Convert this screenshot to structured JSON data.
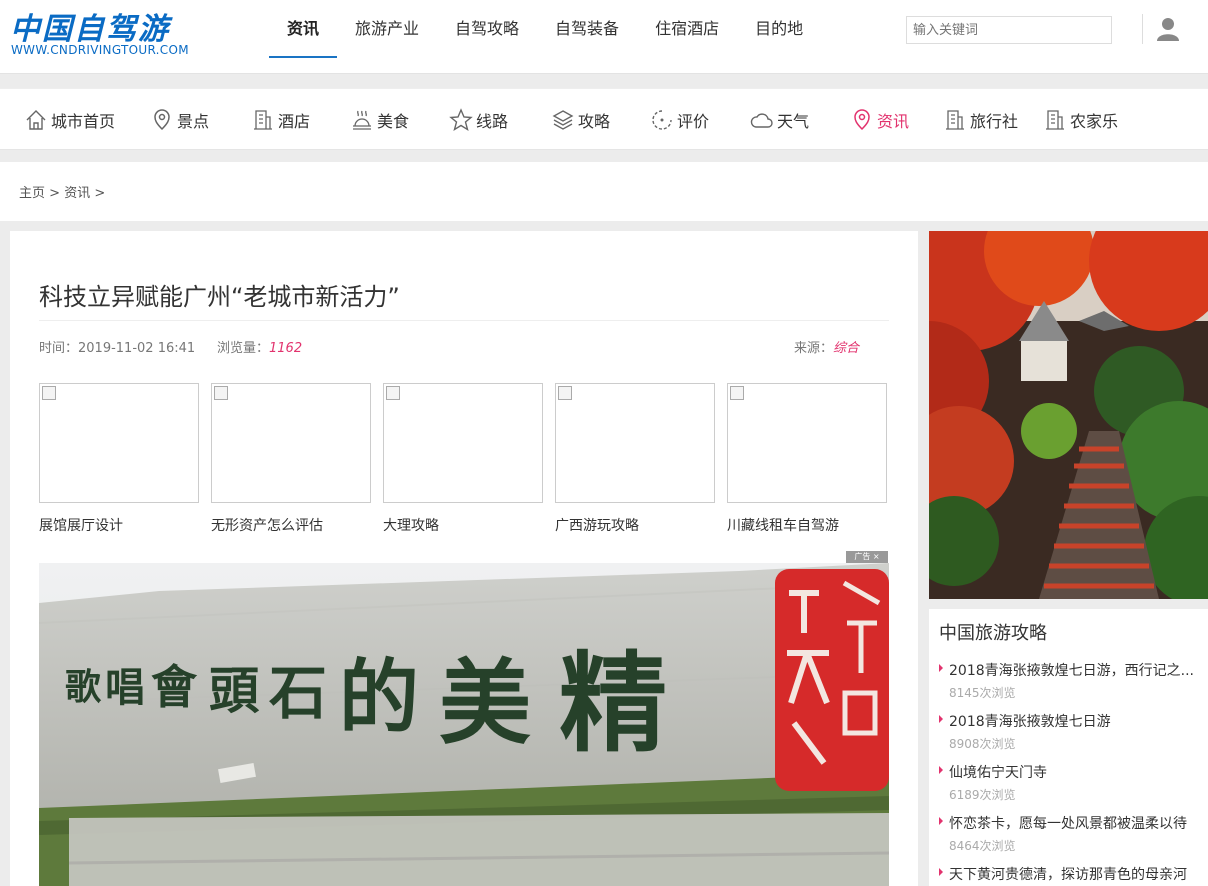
{
  "header": {
    "logo_text": "中国自驾游",
    "logo_url_text": "WWW.CNDRIVINGTOUR.COM",
    "nav": [
      {
        "label": "资讯",
        "active": true
      },
      {
        "label": "旅游产业"
      },
      {
        "label": "自驾攻略"
      },
      {
        "label": "自驾装备"
      },
      {
        "label": "住宿酒店"
      },
      {
        "label": "目的地"
      }
    ],
    "search_placeholder": "输入关键词",
    "user_icon": "user-icon"
  },
  "category_nav": [
    {
      "label": "城市首页",
      "icon": "home-icon"
    },
    {
      "label": "景点",
      "icon": "location-icon"
    },
    {
      "label": "酒店",
      "icon": "building-icon"
    },
    {
      "label": "美食",
      "icon": "food-icon"
    },
    {
      "label": "线路",
      "icon": "star-icon"
    },
    {
      "label": "攻略",
      "icon": "layers-icon"
    },
    {
      "label": "评价",
      "icon": "comment-icon"
    },
    {
      "label": "天气",
      "icon": "cloud-icon"
    },
    {
      "label": "资讯",
      "icon": "news-icon",
      "active": true
    },
    {
      "label": "旅行社",
      "icon": "building-icon"
    },
    {
      "label": "农家乐",
      "icon": "building-icon"
    }
  ],
  "breadcrumb": {
    "home": "主页",
    "sep1": ">",
    "section": "资讯",
    "sep2": ">"
  },
  "article": {
    "title": "科技立异赋能广州“老城市新活力”",
    "time_label": "时间：",
    "time": "2019-11-02 16:41",
    "views_label": "浏览量：",
    "views": "1162",
    "source_label": "来源：",
    "source": "综合"
  },
  "related": [
    {
      "caption": "展馆展厅设计"
    },
    {
      "caption": "无形资产怎么评估"
    },
    {
      "caption": "大理攻略"
    },
    {
      "caption": "广西游玩攻略"
    },
    {
      "caption": "川藏线租车自驾游"
    }
  ],
  "ad_label": "广告",
  "ad_close": "×",
  "stone_image": {
    "chars": [
      "精",
      "美",
      "的",
      "石",
      "頭",
      "會",
      "唱",
      "歌"
    ]
  },
  "sidebar": {
    "title": "中国旅游攻略",
    "items": [
      {
        "title": "2018青海张掖敦煌七日游，西行记之...",
        "views": "8145次浏览"
      },
      {
        "title": "2018青海张掖敦煌七日游",
        "views": "8908次浏览"
      },
      {
        "title": "仙境佑宁天门寺",
        "views": "6189次浏览"
      },
      {
        "title": "怀恋茶卡，愿每一处风景都被温柔以待",
        "views": "8464次浏览"
      },
      {
        "title": "天下黄河贵德清，探访那青色的母亲河",
        "views": ""
      }
    ]
  },
  "colors": {
    "brand": "#0a6bc4",
    "accent": "#e2336e",
    "nav_underline": "#1a74c4"
  }
}
